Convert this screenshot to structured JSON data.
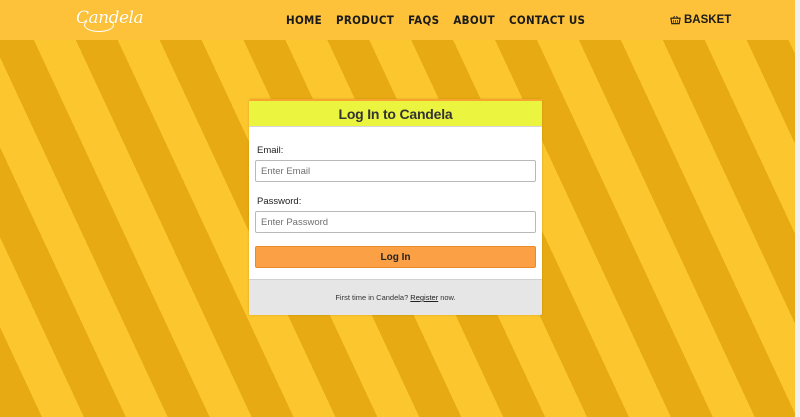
{
  "header": {
    "logo_text": "Candela",
    "nav": [
      {
        "label": "HOME"
      },
      {
        "label": "PRODUCT"
      },
      {
        "label": "FAQS"
      },
      {
        "label": "ABOUT"
      },
      {
        "label": "CONTACT US"
      }
    ],
    "basket_label": "BASKET",
    "basket_icon": "basket-icon"
  },
  "colors": {
    "header_bg": "#fdc23a",
    "stripe_dark": "#e7aa12",
    "stripe_light": "#fcc62e",
    "card_header_bg": "#ebf540",
    "button_bg": "#fba044",
    "footer_bg": "#e6e6e6"
  },
  "login": {
    "title": "Log In to Candela",
    "email_label": "Email:",
    "email_placeholder": "Enter Email",
    "email_value": "",
    "password_label": "Password:",
    "password_placeholder": "Enter Password",
    "password_value": "",
    "submit_label": "Log In",
    "footer_prefix": "First time in Candela?",
    "footer_link": "Register",
    "footer_suffix": "now."
  }
}
